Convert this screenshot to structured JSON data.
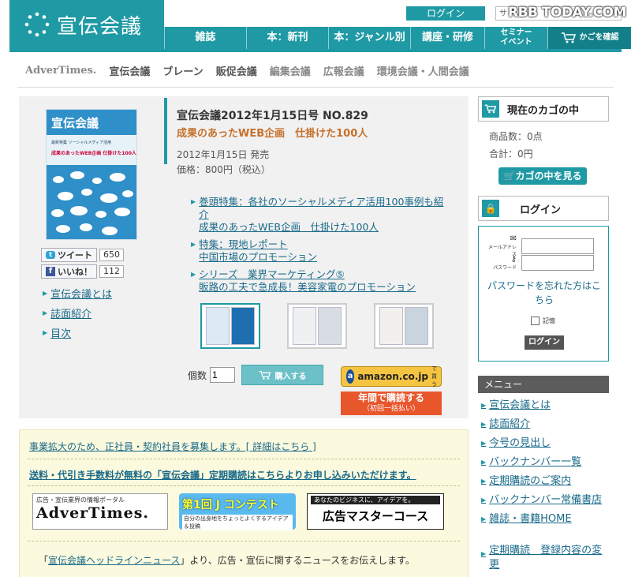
{
  "header": {
    "logo_text": "宣伝会議",
    "login_label": "ログイン",
    "sales_text": "サ",
    "watermark": "RBB TODAY.COM",
    "nav": [
      {
        "label": "雑誌"
      },
      {
        "label": "本：新刊"
      },
      {
        "label": "本：ジャンル別"
      },
      {
        "label": "講座・研修"
      },
      {
        "label_1": "セミナー",
        "label_2": "イベント"
      },
      {
        "label": "かごを確認"
      }
    ]
  },
  "media_links": [
    "AdverTimes.",
    "宣伝会議",
    "ブレーン",
    "販促会議",
    "編集会議",
    "広報会議",
    "環境会議・人間会議"
  ],
  "product": {
    "cover_title": "宣伝会議",
    "cover_text_1": "最新特集 ソーシャルメディア活用",
    "cover_text_2": "成果のあったWEB企画 仕掛けた100人",
    "title": "宣伝会議2012年1月15日号 NO.829",
    "subtitle": "成果のあったWEB企画　仕掛けた100人",
    "date": "2012年1月15日 発売",
    "price": "価格：800円（税込）",
    "tweet_label": "ツイート",
    "tweet_count": "650",
    "like_label": "いいね！",
    "like_count": "112",
    "links": [
      "宣伝会議とは",
      "誌面紹介",
      "目次"
    ],
    "contents": [
      {
        "lines": [
          "巻頭特集：各社のソーシャルメディア活用100事例も紹",
          "介",
          "成果のあったWEB企画　仕掛けた100人"
        ]
      },
      {
        "lines": [
          "特集：現地レポート",
          "中国市場のプロモーション"
        ]
      },
      {
        "lines": [
          "シリーズ　業界マーケティング⑤",
          "販路の工夫で急成長！美容家電のプロモーション"
        ]
      }
    ],
    "qty_label": "個数",
    "qty_value": "1",
    "buy_label": "購入する",
    "amazon_label": "amazon.co.jp",
    "amazon_sub": "で買う",
    "annual_label": "年間で購読する",
    "annual_sub": "（初回一括払い）"
  },
  "notice": {
    "recruit": "事業拡大のため、正社員・契約社員を募集します。[ 詳細はこちら ]",
    "subscription": "送料・代引き手数料が無料の「宣伝会議」定期購読はこちらよりお申し込みいただけます。",
    "banner1_top": "広告・宣伝業界の情報ポータル",
    "banner1_main": "AdverTimes.",
    "banner2_top": "第1回 J コンテスト",
    "banner2_sub": "自分の出身地をちょっとよくするアイデア＆投稿",
    "banner3_top": "あなたのビジネスに、アイデアを。",
    "banner3_main": "広告マスターコース",
    "footer_pre": "「",
    "footer_link": "宣伝会議ヘッドラインニュース",
    "footer_post": "」より、広告・宣伝に関するニュースをお伝えします。"
  },
  "sidebar": {
    "cart_title": "現在のカゴの中",
    "cart_count": "商品数：0点",
    "cart_total": "合計：0円",
    "cart_button": "カゴの中を見る",
    "login_title": "ログイン",
    "email_label": "メールアドレス",
    "password_label": "パスワード",
    "forgot_link": "パスワードを忘れた方はこちら",
    "remember_label": "記憶",
    "login_button": "ログイン",
    "menu_title": "メニュー",
    "menu": [
      "宣伝会議とは",
      "誌面紹介",
      "今号の見出し",
      "バックナンバー一覧",
      "定期購読のご案内",
      "バックナンバー常備書店",
      "雑誌・書籍HOME"
    ],
    "menu_extra": "定期購読　登録内容の変更"
  },
  "colors": {
    "brand": "#1f9aa5",
    "accent_orange": "#e8562c",
    "amazon": "#f5c542"
  }
}
